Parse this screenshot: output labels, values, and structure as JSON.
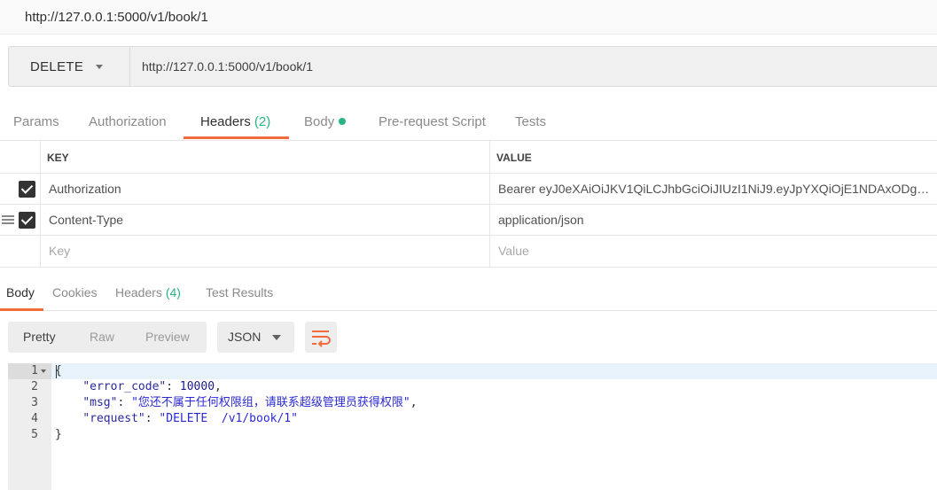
{
  "window": {
    "title": "http://127.0.0.1:5000/v1/book/1"
  },
  "request": {
    "method": "DELETE",
    "url": "http://127.0.0.1:5000/v1/book/1"
  },
  "request_tabs": [
    {
      "label": "Params"
    },
    {
      "label": "Authorization"
    },
    {
      "label": "Headers",
      "count": "(2)"
    },
    {
      "label": "Body"
    },
    {
      "label": "Pre-request Script"
    },
    {
      "label": "Tests"
    }
  ],
  "headers_table": {
    "key_header": "KEY",
    "value_header": "VALUE",
    "rows": [
      {
        "key": "Authorization",
        "value": "Bearer eyJ0eXAiOiJKV1QiLCJhbGciOiJIUzI1NiJ9.eyJpYXQiOjE1NDAxODgw...",
        "checked": true
      },
      {
        "key": "Content-Type",
        "value": "application/json",
        "checked": true
      }
    ],
    "key_placeholder": "Key",
    "value_placeholder": "Value"
  },
  "response_tabs": [
    {
      "label": "Body"
    },
    {
      "label": "Cookies"
    },
    {
      "label": "Headers",
      "count": "(4)"
    },
    {
      "label": "Test Results"
    }
  ],
  "view_modes": [
    {
      "label": "Pretty"
    },
    {
      "label": "Raw"
    },
    {
      "label": "Preview"
    }
  ],
  "format": "JSON",
  "code": {
    "line_numbers": [
      "1",
      "2",
      "3",
      "4",
      "5"
    ],
    "open_brace": "{",
    "close_brace": "}",
    "error_code_key": "\"error_code\"",
    "error_code_value": "10000",
    "msg_key": "\"msg\"",
    "msg_value": "\"您还不属于任何权限组，请联系超级管理员获得权限\"",
    "request_key": "\"request\"",
    "request_value": "\"DELETE  /v1/book/1\""
  },
  "colors": {
    "accent": "#f26b3a",
    "count_green": "#26b47f"
  }
}
